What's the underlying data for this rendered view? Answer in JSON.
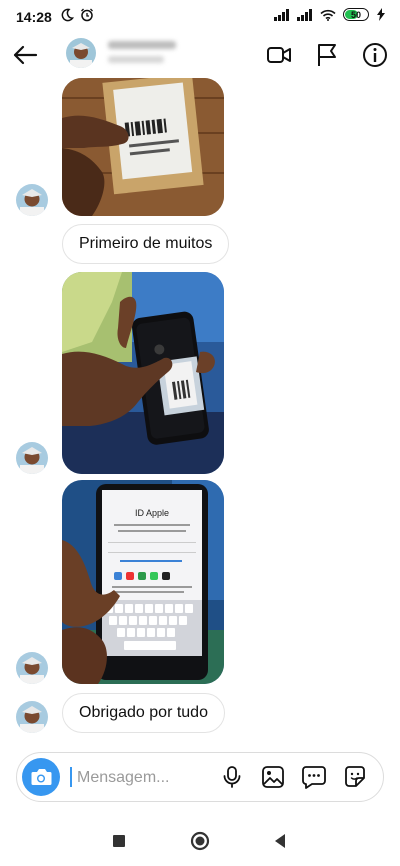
{
  "status_bar": {
    "time": "14:28",
    "battery": "50",
    "icons": [
      "moon-icon",
      "alarm-icon",
      "signal-icon",
      "signal-icon",
      "wifi-icon",
      "battery-icon",
      "charging-icon"
    ]
  },
  "header": {
    "icons": [
      "back-arrow-icon",
      "video-call-icon",
      "flag-icon",
      "info-icon"
    ]
  },
  "messages": [
    {
      "type": "photo",
      "subject": "package-in-hand"
    },
    {
      "type": "text",
      "text": "Primeiro de muitos"
    },
    {
      "type": "photo",
      "subject": "phone-in-hand"
    },
    {
      "type": "photo",
      "subject": "phone-apple-id-screen",
      "screen_title": "ID Apple"
    },
    {
      "type": "text",
      "text": "Obrigado por tudo"
    }
  ],
  "composer": {
    "placeholder": "Mensagem...",
    "value": "",
    "icons": [
      "camera-icon",
      "microphone-icon",
      "gallery-icon",
      "chat-dots-icon",
      "sticker-icon"
    ]
  },
  "nav_bar": {
    "icons": [
      "recents-icon",
      "home-icon",
      "back-icon"
    ]
  },
  "colors": {
    "accent": "#3797f0",
    "bubble_border": "#e3e3e3",
    "background": "#ffffff"
  }
}
